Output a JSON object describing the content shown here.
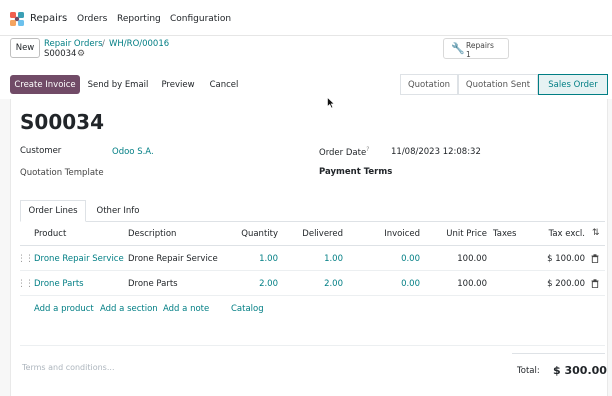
{
  "navbar": {
    "app_name": "Repairs",
    "menu": [
      "Orders",
      "Reporting",
      "Configuration"
    ]
  },
  "control": {
    "new_label": "New",
    "breadcrumb_parent": "Repair Orders",
    "breadcrumb_separator": "/",
    "breadcrumb_current": "WH/RO/00016",
    "record_name": "S00034",
    "smart_button": {
      "label": "Repairs",
      "count": "1"
    }
  },
  "actions": {
    "create_invoice": "Create Invoice",
    "send_by_email": "Send by Email",
    "preview": "Preview",
    "cancel": "Cancel"
  },
  "statusbar": {
    "stages": [
      "Quotation",
      "Quotation Sent",
      "Sales Order"
    ],
    "active": "Sales Order"
  },
  "form": {
    "title": "S00034",
    "customer_label": "Customer",
    "customer_value": "Odoo S.A.",
    "template_label": "Quotation Template",
    "order_date_label": "Order Date",
    "order_date_help": "?",
    "order_date_value": "11/08/2023 12:08:32",
    "payment_terms_label": "Payment Terms"
  },
  "tabs": [
    "Order Lines",
    "Other Info"
  ],
  "table": {
    "columns": [
      "Product",
      "Description",
      "Quantity",
      "Delivered",
      "Invoiced",
      "Unit Price",
      "Taxes",
      "Tax excl."
    ],
    "rows": [
      {
        "product": "Drone Repair Service",
        "description": "Drone Repair Service",
        "quantity": "1.00",
        "delivered": "1.00",
        "invoiced": "0.00",
        "unit_price": "100.00",
        "taxes": "",
        "subtotal": "$ 100.00"
      },
      {
        "product": "Drone Parts",
        "description": "Drone Parts",
        "quantity": "2.00",
        "delivered": "2.00",
        "invoiced": "0.00",
        "unit_price": "100.00",
        "taxes": "",
        "subtotal": "$ 200.00"
      }
    ],
    "add_product": "Add a product",
    "add_section": "Add a section",
    "add_note": "Add a note",
    "catalog": "Catalog"
  },
  "footer": {
    "terms_placeholder": "Terms and conditions...",
    "total_label": "Total:",
    "total_value": "$ 300.00"
  },
  "colors": {
    "brand": "#714b67",
    "link": "#017e84"
  }
}
